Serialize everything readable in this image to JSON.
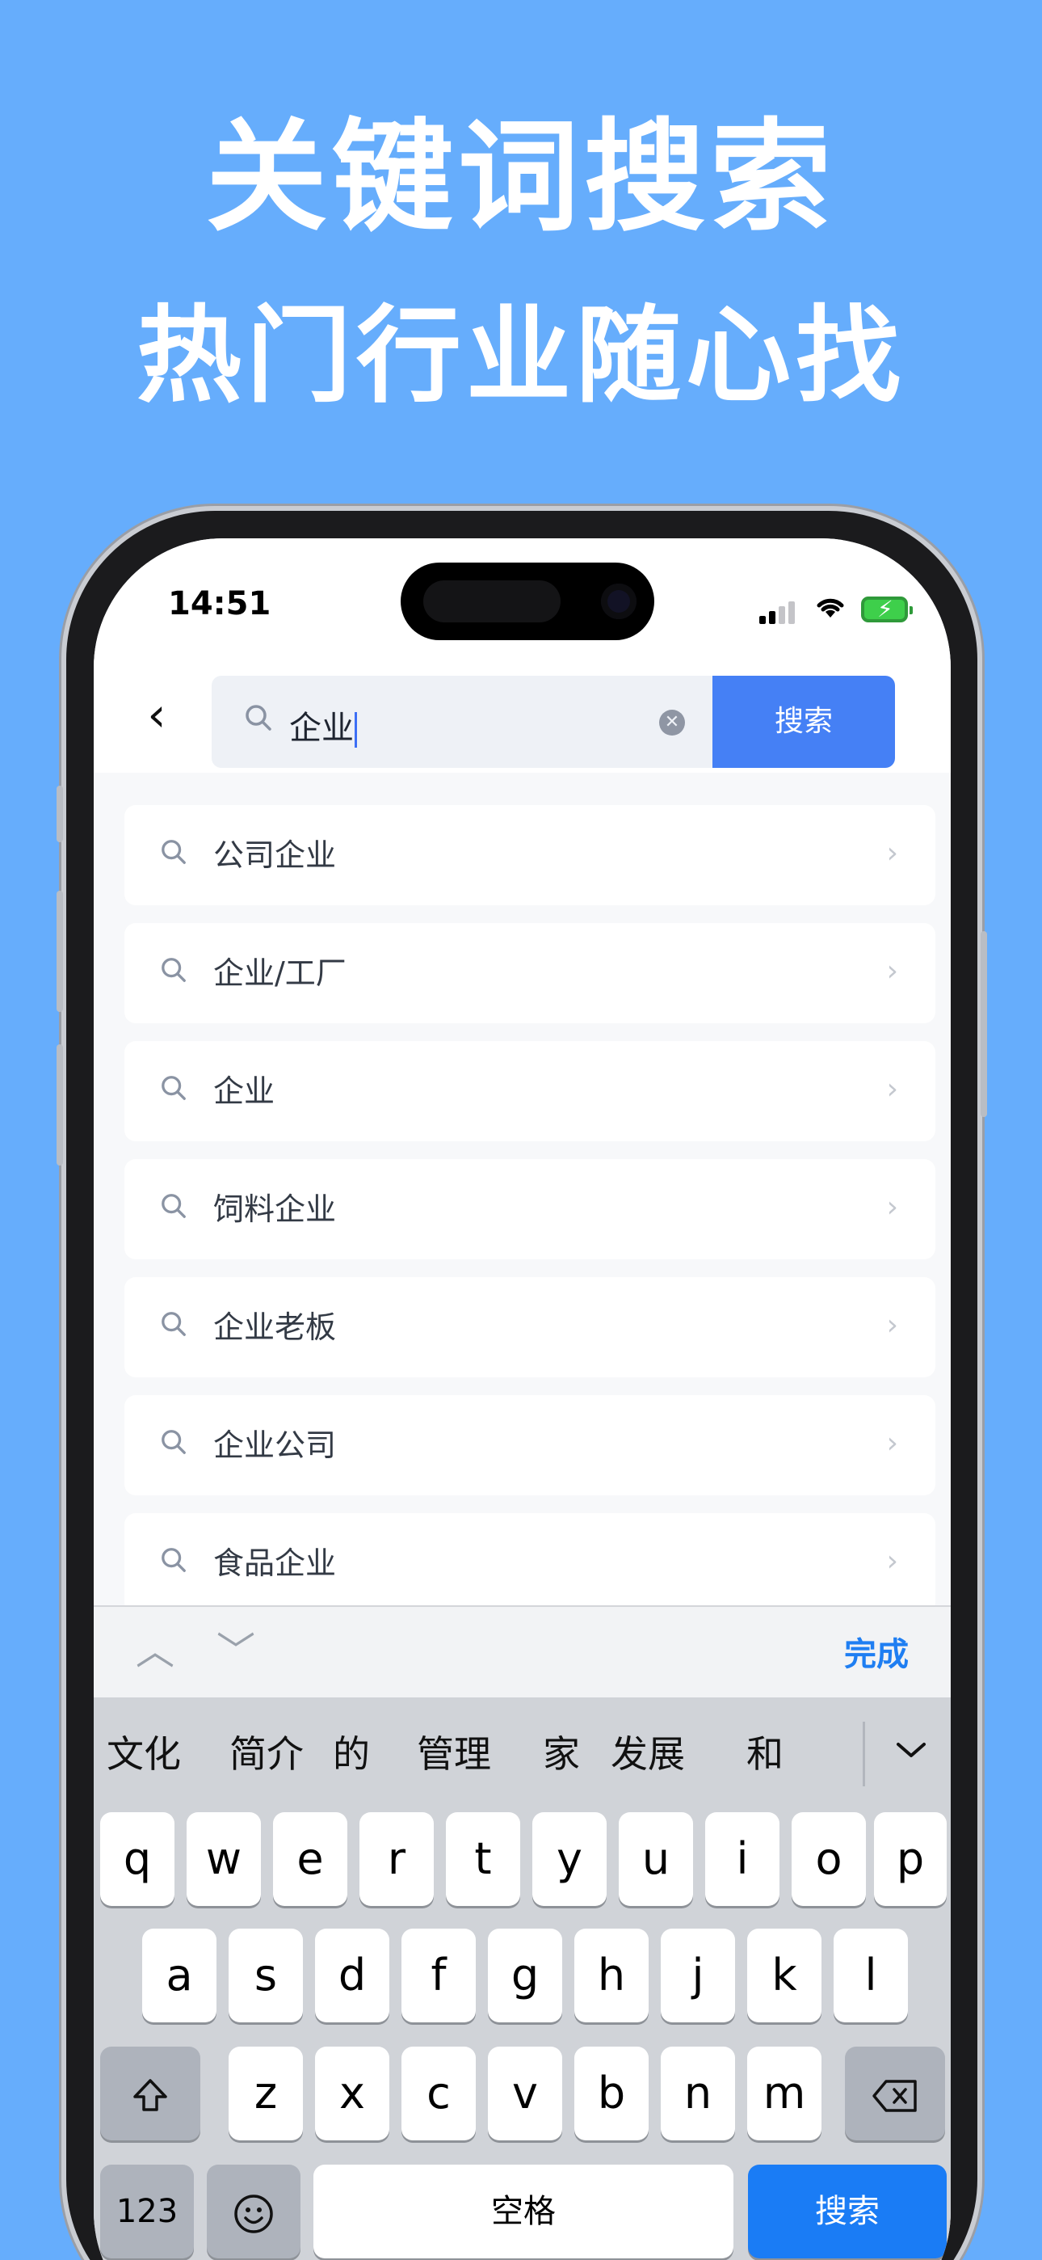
{
  "promo": {
    "line1": "关键词搜索",
    "line2": "热门行业随心找"
  },
  "status_bar": {
    "time": "14:51"
  },
  "search": {
    "back_icon": "chevron-left-icon",
    "search_icon": "magnifier-icon",
    "query": "企业",
    "clear_icon": "clear-x-icon",
    "button_label": "搜索"
  },
  "suggestions": [
    {
      "label": "公司企业"
    },
    {
      "label": "企业/工厂"
    },
    {
      "label": "企业"
    },
    {
      "label": "饲料企业"
    },
    {
      "label": "企业老板"
    },
    {
      "label": "企业公司"
    },
    {
      "label": "食品企业"
    }
  ],
  "keyboard_accessory": {
    "done_label": "完成"
  },
  "keyboard": {
    "candidates": [
      "文化",
      "简介",
      "的",
      "管理",
      "家",
      "发展",
      "和"
    ],
    "row1": [
      "q",
      "w",
      "e",
      "r",
      "t",
      "y",
      "u",
      "i",
      "o",
      "p"
    ],
    "row2": [
      "a",
      "s",
      "d",
      "f",
      "g",
      "h",
      "j",
      "k",
      "l"
    ],
    "row3": [
      "z",
      "x",
      "c",
      "v",
      "b",
      "n",
      "m"
    ],
    "numbers_label": "123",
    "space_label": "空格",
    "return_label": "搜索"
  },
  "colors": {
    "background": "#66adfc",
    "accent": "#4580f5",
    "keyboard_return": "#1a7cf5"
  }
}
